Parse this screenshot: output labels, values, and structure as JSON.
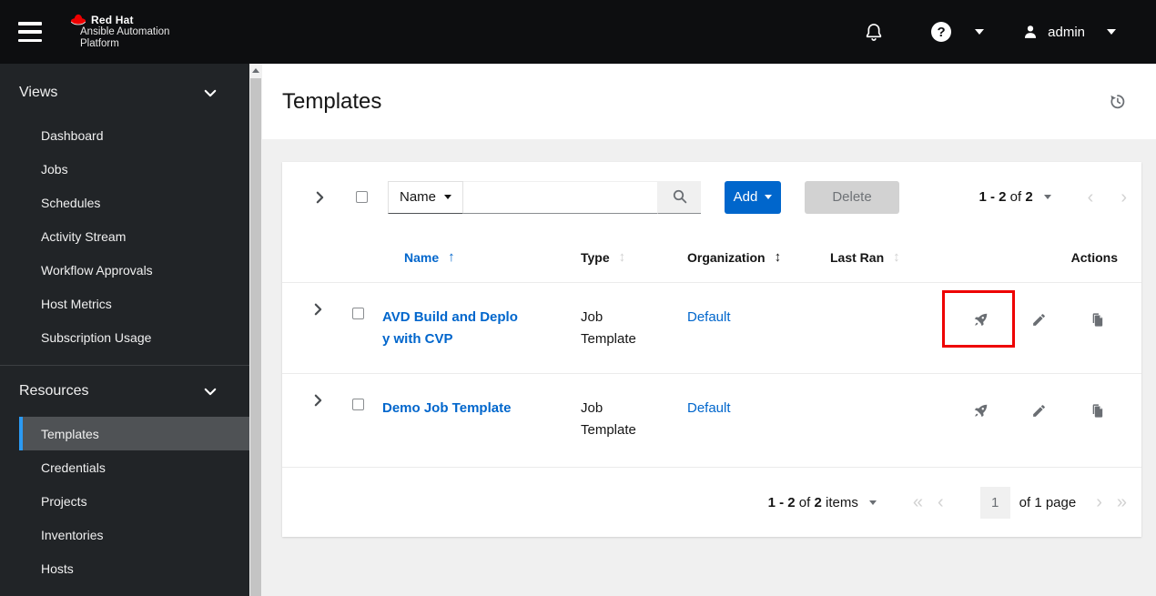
{
  "masthead": {
    "brand": {
      "line1": "Red Hat",
      "line2": "Ansible Automation",
      "line3": "Platform"
    },
    "username": "admin",
    "help_glyph": "?"
  },
  "sidebar": {
    "sections": [
      {
        "label": "Views",
        "items": [
          {
            "label": "Dashboard"
          },
          {
            "label": "Jobs"
          },
          {
            "label": "Schedules"
          },
          {
            "label": "Activity Stream"
          },
          {
            "label": "Workflow Approvals"
          },
          {
            "label": "Host Metrics"
          },
          {
            "label": "Subscription Usage"
          }
        ]
      },
      {
        "label": "Resources",
        "items": [
          {
            "label": "Templates",
            "active": true
          },
          {
            "label": "Credentials"
          },
          {
            "label": "Projects"
          },
          {
            "label": "Inventories"
          },
          {
            "label": "Hosts"
          }
        ]
      }
    ]
  },
  "page": {
    "title": "Templates"
  },
  "toolbar": {
    "filter": {
      "selected": "Name"
    },
    "search": {
      "placeholder": "",
      "value": ""
    },
    "add_label": "Add",
    "delete_label": "Delete",
    "pagination": {
      "range": "1 - 2",
      "of_word": "of",
      "total": "2"
    }
  },
  "table": {
    "headers": {
      "name": "Name",
      "type": "Type",
      "organization": "Organization",
      "last_ran": "Last Ran",
      "actions": "Actions"
    },
    "sort_glyphs": {
      "ascending": "↑",
      "unsorted": "↕"
    },
    "rows": [
      {
        "name": "AVD Build and Deploy with CVP",
        "type": "Job Template",
        "organization": "Default",
        "last_ran": "",
        "launch_highlighted": true
      },
      {
        "name": "Demo Job Template",
        "type": "Job Template",
        "organization": "Default",
        "last_ran": "",
        "launch_highlighted": false
      }
    ]
  },
  "footer": {
    "items_range": "1 - 2",
    "of_word": "of",
    "items_total": "2",
    "items_word": "items",
    "current_page": "1",
    "page_count_label": "of 1 page"
  },
  "colors": {
    "brand_red": "#ee0000",
    "link_blue": "#0066cc",
    "primary_button_blue": "#0066cc",
    "highlight_red": "#ee0000",
    "nav_active_indicator": "#2b9af3",
    "masthead_bg": "#0d0e10",
    "sidebar_bg": "#212427"
  }
}
